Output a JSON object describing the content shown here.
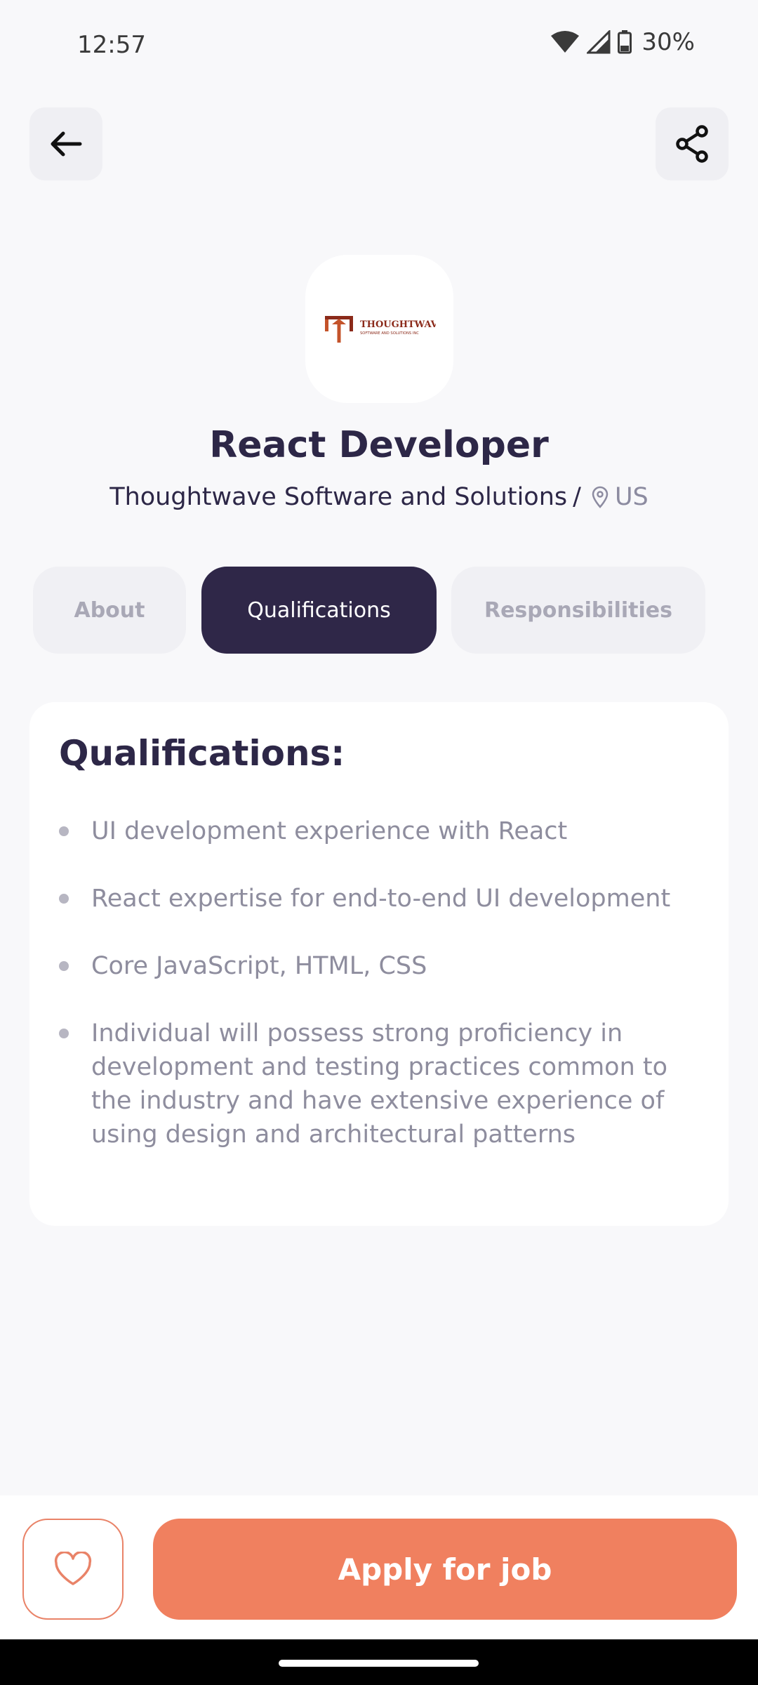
{
  "status": {
    "time": "12:57",
    "battery": "30%",
    "icons": [
      "wifi-icon",
      "signal-icon",
      "battery-icon"
    ]
  },
  "header": {
    "back_icon": "arrow-left-icon",
    "share_icon": "share-icon"
  },
  "job": {
    "logo_text": "THOUGHTWAVE",
    "logo_subtext": "SOFTWARE AND SOLUTIONS INC",
    "title": "React Developer",
    "company": "Thoughtwave Software and Solutions",
    "separator": "/",
    "location": "US"
  },
  "tabs": [
    {
      "label": "About",
      "active": false
    },
    {
      "label": "Qualifications",
      "active": true
    },
    {
      "label": "Responsibilities",
      "active": false
    }
  ],
  "qualifications": {
    "heading": "Qualifications:",
    "items": [
      "UI development experience with React",
      "React expertise for end-to-end UI development",
      "Core JavaScript, HTML, CSS",
      "Individual will possess strong proficiency in development and testing practices common to the industry and have extensive experience of using design and architectural patterns"
    ]
  },
  "actions": {
    "favorite_icon": "heart-icon",
    "apply_label": "Apply for job"
  },
  "colors": {
    "primary_dark": "#2f2748",
    "accent": "#f0805f",
    "background": "#f8f8fa"
  }
}
